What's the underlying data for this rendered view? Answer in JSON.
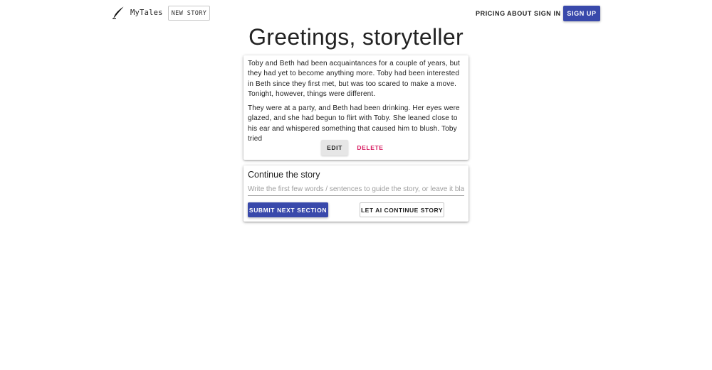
{
  "header": {
    "logo_icon": "quill-pen-icon",
    "brand": "MyTales",
    "new_story_label": "NEW STORY",
    "nav": {
      "pricing": "PRICING",
      "about": "ABOUT",
      "sign_in": "SIGN IN",
      "sign_up": "SIGN UP"
    },
    "accent_color": "#3949ab"
  },
  "main": {
    "title": "Greetings, storyteller",
    "story": {
      "paragraphs": [
        "Toby and Beth had been acquaintances for a couple of years, but they had yet to become anything more. Toby had been interested in Beth since they first met, but was too scared to make a move. Tonight, however, things were different.",
        "They were at a party, and Beth had been drinking. Her eyes were glazed, and she had begun to flirt with Toby. She leaned close to his ear and whispered something that caused him to blush. Toby tried"
      ],
      "edit_label": "EDIT",
      "delete_label": "DELETE",
      "delete_color": "#d81b60"
    },
    "continue": {
      "title": "Continue the story",
      "input_placeholder": "Write the first few words / sentences to guide the story, or leave it blank",
      "input_value": "",
      "submit_label": "SUBMIT NEXT SECTION",
      "ai_label": "LET AI CONTINUE STORY"
    }
  }
}
